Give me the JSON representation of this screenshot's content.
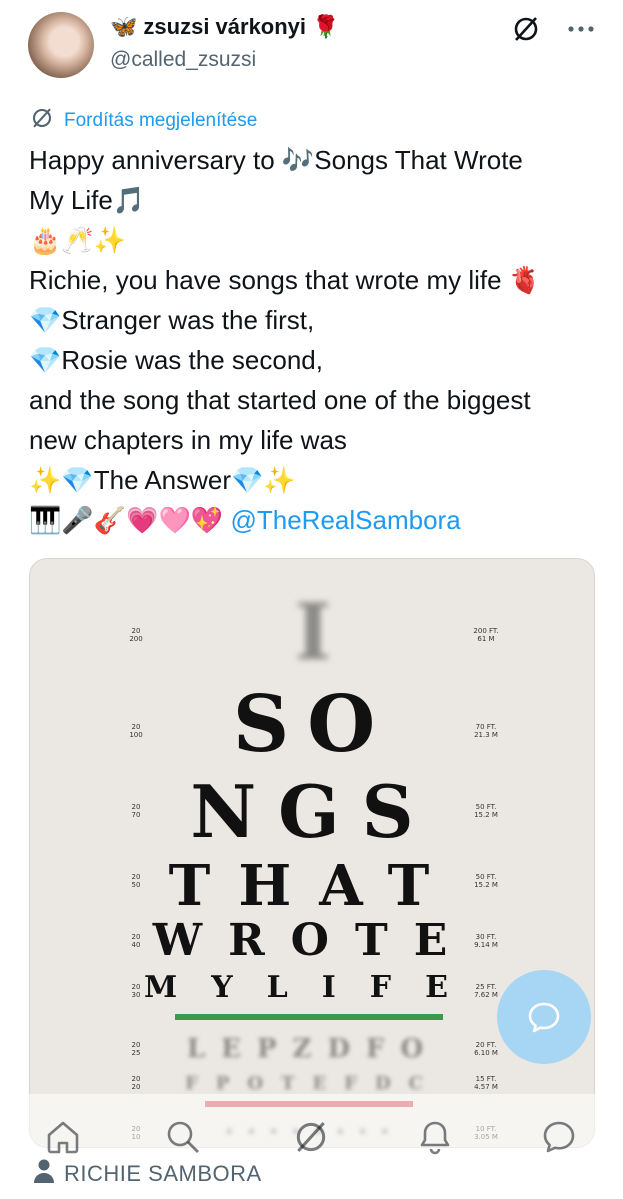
{
  "author": {
    "name_prefix_emoji": "🦋",
    "display_name": "zsuzsi várkonyi",
    "name_suffix_emoji": "🌹",
    "handle": "@called_zsuzsi"
  },
  "header_icons": [
    "grok-icon",
    "more-icon"
  ],
  "translate_label": "Fordítás megjelenítése",
  "tweet": {
    "lines": [
      "Happy anniversary to 🎶Songs That Wrote",
      "My Life🎵",
      "🎂🥂✨",
      "Richie, you have songs that wrote my life 🫀",
      "💎Stranger was the first,",
      "💎Rosie was the second,",
      "and the song that started one of the biggest",
      "new chapters in my life was",
      "✨💎The Answer💎✨"
    ],
    "last_line_emojis": "🎹🎤🎸💗🩷💖",
    "mention": "@TheRealSambora"
  },
  "eye_chart": {
    "rows": [
      {
        "text": "I",
        "left": "20\n200",
        "right": "200 FT.\n61 M",
        "blurred": true
      },
      {
        "text": "SO",
        "left": "20\n100",
        "right": "70 FT.\n21.3 M",
        "blurred": false
      },
      {
        "text": "NGS",
        "left": "20\n70",
        "right": "50 FT.\n15.2 M",
        "blurred": false
      },
      {
        "text": "THAT",
        "left": "20\n50",
        "right": "50 FT.\n15.2 M",
        "blurred": false
      },
      {
        "text": "WROTE",
        "left": "20\n40",
        "right": "30 FT.\n9.14 M",
        "blurred": false
      },
      {
        "text": "MYLIFE",
        "left": "20\n30",
        "right": "25 FT.\n7.62 M",
        "blurred": false
      },
      {
        "text": "LEPZDFO",
        "left": "20\n25",
        "right": "20 FT.\n6.10 M",
        "blurred": true
      },
      {
        "text": "FPOTEFDC",
        "left": "20\n20",
        "right": "15 FT.\n4.57 M",
        "blurred": true
      },
      {
        "text": "••••••••",
        "left": "20\n10",
        "right": "10 FT.\n3.05 M",
        "blurred": true
      }
    ],
    "green_line_color": "#3a9a4a",
    "red_line_color": "#d24b4b"
  },
  "fab_icon": "compose-reply-icon",
  "nav": [
    "home-icon",
    "search-icon",
    "grok-icon",
    "notifications-icon",
    "messages-icon"
  ],
  "caption": {
    "icon": "person-icon",
    "text": "RICHIE SAMBORA"
  },
  "colors": {
    "accent": "#1d9bf0",
    "text": "#0f1419",
    "muted": "#536471"
  }
}
